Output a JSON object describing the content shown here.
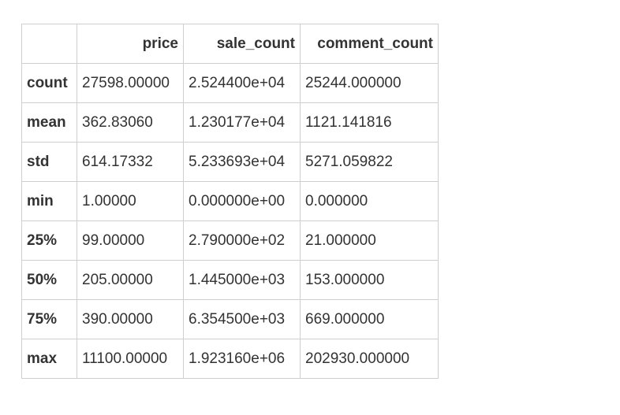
{
  "table": {
    "index_header": "",
    "columns": [
      "price",
      "sale_count",
      "comment_count"
    ],
    "rows": [
      {
        "label": "count",
        "values": [
          "27598.00000",
          "2.524400e+04",
          "25244.000000"
        ]
      },
      {
        "label": "mean",
        "values": [
          "362.83060",
          "1.230177e+04",
          "1121.141816"
        ]
      },
      {
        "label": "std",
        "values": [
          "614.17332",
          "5.233693e+04",
          "5271.059822"
        ]
      },
      {
        "label": "min",
        "values": [
          "1.00000",
          "0.000000e+00",
          "0.000000"
        ]
      },
      {
        "label": "25%",
        "values": [
          "99.00000",
          "2.790000e+02",
          "21.000000"
        ]
      },
      {
        "label": "50%",
        "values": [
          "205.00000",
          "1.445000e+03",
          "153.000000"
        ]
      },
      {
        "label": "75%",
        "values": [
          "390.00000",
          "6.354500e+03",
          "669.000000"
        ]
      },
      {
        "label": "max",
        "values": [
          "11100.00000",
          "1.923160e+06",
          "202930.000000"
        ]
      }
    ]
  }
}
